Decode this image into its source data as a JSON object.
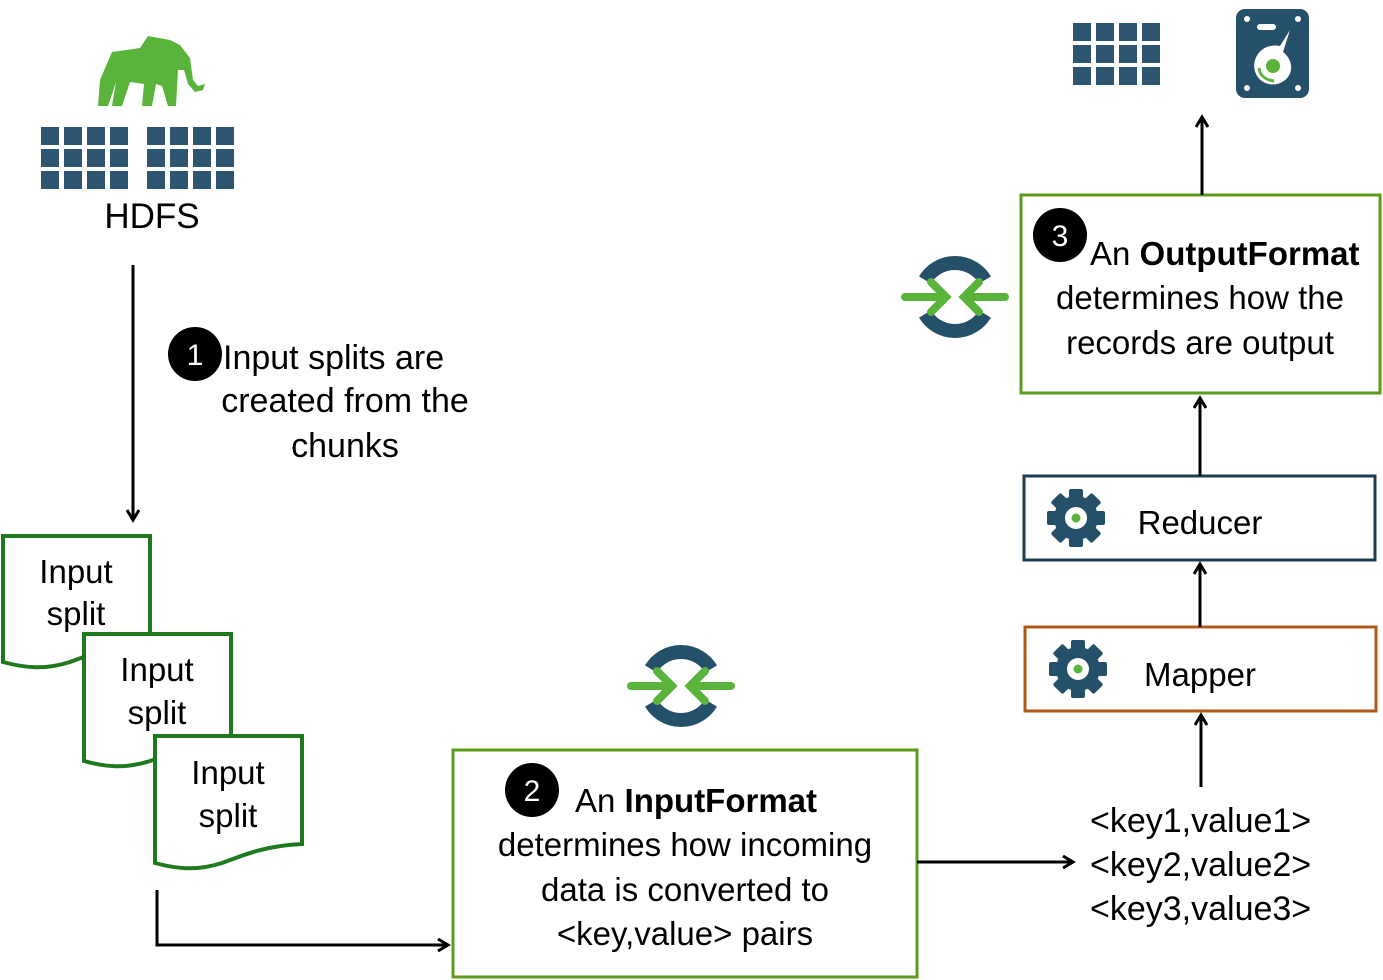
{
  "colors": {
    "hdfs_blue": "#2f5671",
    "elephant_green": "#5ab43c",
    "split_green": "#1f7a1f",
    "format_box_green": "#5e9a1c",
    "reducer_border": "#1e3e50",
    "mapper_border": "#b05a1a",
    "arrow_green": "#5ab43c",
    "sync_ring_blue": "#24506a"
  },
  "hdfs": {
    "label": "HDFS",
    "icons": [
      "hadoop-elephant-icon",
      "block-grid-icon"
    ]
  },
  "step1": {
    "number": "1",
    "lines": [
      "Input splits are",
      "created from the",
      "chunks"
    ]
  },
  "input_splits": [
    {
      "line1": "Input",
      "line2": "split"
    },
    {
      "line1": "Input",
      "line2": "split"
    },
    {
      "line1": "Input",
      "line2": "split"
    }
  ],
  "step2": {
    "number": "2",
    "prefix": "An ",
    "bold": "InputFormat",
    "lines": [
      "determines how incoming",
      "data is converted to",
      "<key,value> pairs"
    ]
  },
  "key_values": [
    "<key1,value1>",
    "<key2,value2>",
    "<key3,value3>"
  ],
  "mapper": {
    "label": "Mapper",
    "icon": "gear-icon"
  },
  "reducer": {
    "label": "Reducer",
    "icon": "gear-icon"
  },
  "step3": {
    "number": "3",
    "prefix": "An ",
    "bold": "OutputFormat",
    "lines": [
      "determines how the",
      "records are output"
    ]
  },
  "output_icons": [
    "block-grid-icon",
    "hard-disk-icon"
  ],
  "sync_icon": "sync-arrows-icon"
}
